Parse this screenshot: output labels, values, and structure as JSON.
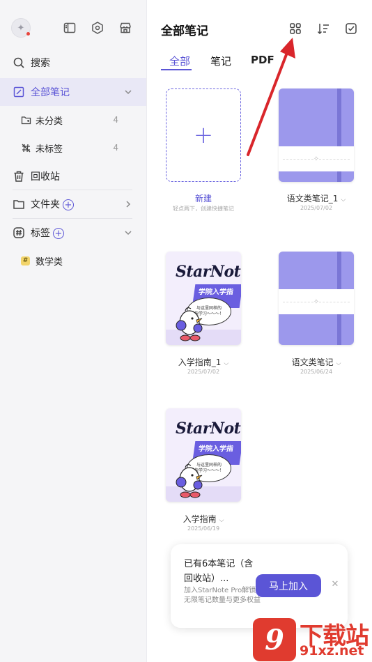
{
  "sidebar": {
    "search": "搜索",
    "all_notes": "全部笔记",
    "uncategorized": "未分类",
    "uncategorized_count": "4",
    "untagged": "未标签",
    "untagged_count": "4",
    "recycle_bin": "回收站",
    "folders": "文件夹",
    "tags": "标签",
    "tag_items": [
      {
        "label": "数学类"
      }
    ]
  },
  "header": {
    "title": "全部笔记",
    "icons": [
      "grid-view-icon",
      "sort-icon",
      "select-check-icon"
    ]
  },
  "tabs": [
    {
      "label": "全部",
      "active": true
    },
    {
      "label": "笔记",
      "active": false
    },
    {
      "label": "PDF",
      "active": false
    }
  ],
  "notes": [
    {
      "type": "new",
      "name": "新建",
      "hint": "轻点两下，创建快捷笔记"
    },
    {
      "type": "notebook",
      "name": "语文类笔记_1",
      "date": "2025/07/02"
    },
    {
      "type": "guide",
      "name": "入学指南_1",
      "date": "2025/07/02"
    },
    {
      "type": "notebook",
      "name": "语文类笔记",
      "date": "2025/06/24"
    },
    {
      "type": "guide",
      "name": "入学指南",
      "date": "2025/06/19"
    }
  ],
  "guide_cover": {
    "logo": "StarNote",
    "banner": "学院入学指南",
    "bubble_line1": "与这里同样的",
    "bubble_line2": "快学习～～～！"
  },
  "promo": {
    "title": "已有6本笔记（含回收站）...",
    "desc": "加入StarNote Pro解锁无限笔记数量与更多权益",
    "button": "马上加入"
  },
  "watermark": {
    "mark": "9",
    "top": "下载站",
    "url": "91xz.net"
  },
  "colors": {
    "accent": "#5b55d6",
    "notebook_cover": "#9c98ec",
    "annotation_arrow": "#d9262b"
  }
}
